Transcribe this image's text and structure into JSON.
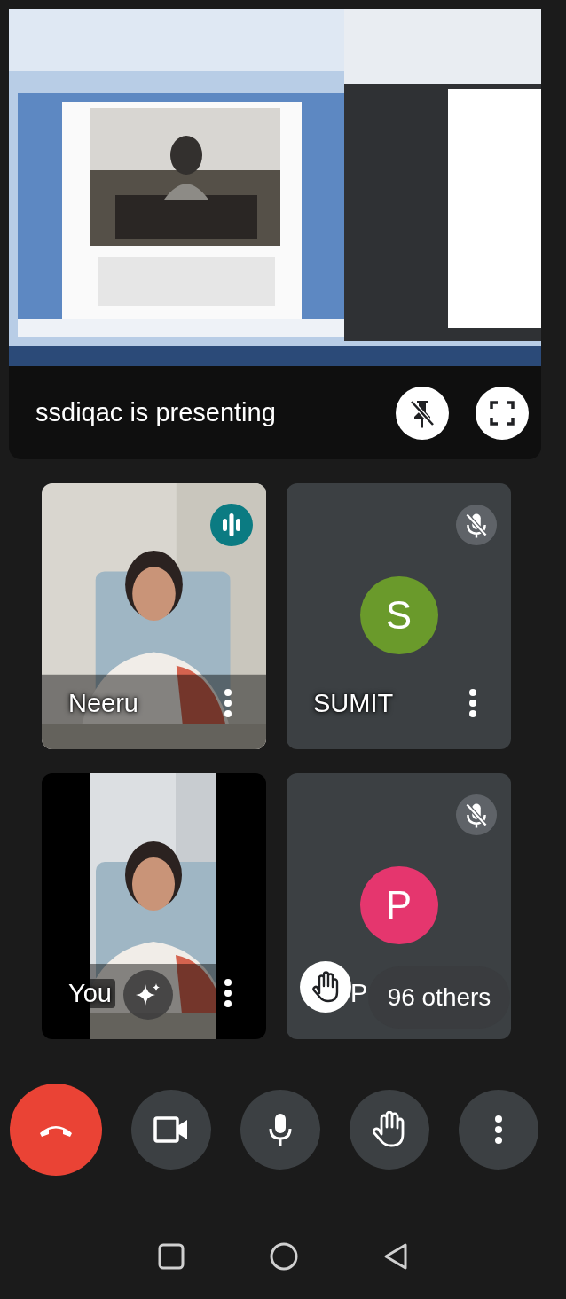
{
  "presentation": {
    "kind": "picture",
    "caption": "ssdiqac is presenting",
    "buttons": [
      {
        "kind": "unpin"
      },
      {
        "kind": "fullscreen"
      }
    ]
  },
  "participants": [
    {
      "name": "Neeru",
      "kind": "video",
      "speaking": true,
      "muted": false
    },
    {
      "name": "SUMIT",
      "kind": "avatar",
      "letter": "S",
      "color": "#6a9a2b",
      "speaking": false,
      "muted": true
    },
    {
      "name": "You",
      "kind": "selfview",
      "speaking": false,
      "muted": false
    },
    {
      "name": "P",
      "kind": "avatar",
      "letter": "P",
      "color": "#e5366e",
      "speaking": false,
      "muted": true
    }
  ],
  "others": {
    "label": "96 others",
    "hand_raised": true
  },
  "controls": [
    {
      "kind": "leave"
    },
    {
      "kind": "camera"
    },
    {
      "kind": "mic"
    },
    {
      "kind": "hand"
    },
    {
      "kind": "more"
    }
  ],
  "nav": [
    {
      "kind": "recents"
    },
    {
      "kind": "home"
    },
    {
      "kind": "back"
    }
  ]
}
